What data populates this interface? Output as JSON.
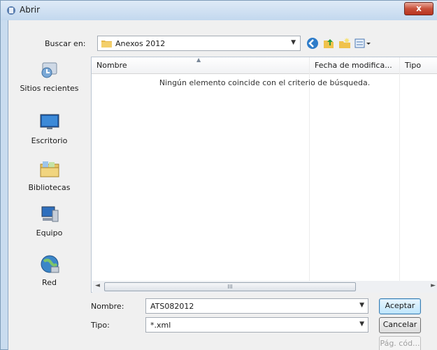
{
  "window": {
    "title": "Abrir",
    "close_label": "x"
  },
  "toolbar": {
    "lookin_label": "Buscar en:",
    "lookin_value": "Anexos 2012"
  },
  "places": [
    {
      "label": "Sitios recientes"
    },
    {
      "label": "Escritorio"
    },
    {
      "label": "Bibliotecas"
    },
    {
      "label": "Equipo"
    },
    {
      "label": "Red"
    }
  ],
  "list": {
    "columns": [
      "Nombre",
      "Fecha de modifica...",
      "Tipo"
    ],
    "empty_message": "Ningún elemento coincide con el criterio de búsqueda.",
    "scroll_grip": "III"
  },
  "filename": {
    "label": "Nombre:",
    "value": "ATS082012"
  },
  "filetype": {
    "label": "Tipo:",
    "value": "*.xml"
  },
  "buttons": {
    "accept": "Aceptar",
    "cancel": "Cancelar",
    "codepage": "Pág. cód..."
  },
  "colors": {
    "title_gradient_top": "#dfeaf7",
    "close_red": "#c8503a",
    "default_button_border": "#3c7fb1"
  }
}
